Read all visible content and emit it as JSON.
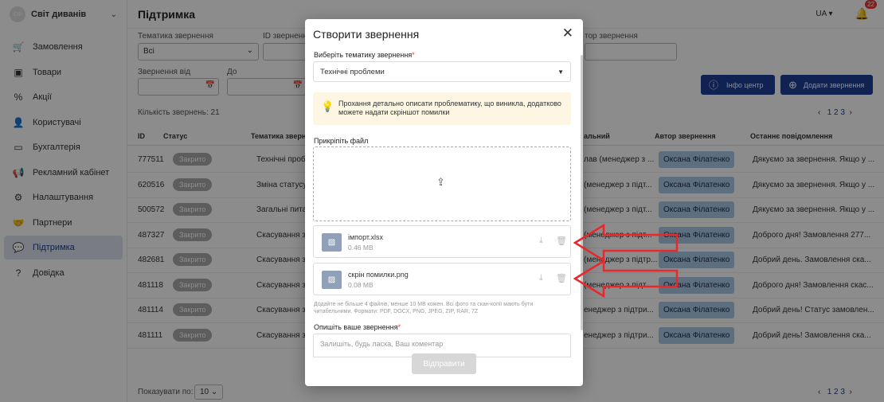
{
  "sidebar": {
    "brand_logo": "СФ",
    "brand_name": "Світ диванів",
    "items": [
      {
        "label": "Замовлення",
        "icon": "cart-icon"
      },
      {
        "label": "Товари",
        "icon": "box-icon"
      },
      {
        "label": "Акції",
        "icon": "tag-icon"
      },
      {
        "label": "Користувачі",
        "icon": "users-icon"
      },
      {
        "label": "Бухгалтерія",
        "icon": "wallet-icon"
      },
      {
        "label": "Рекламний кабінет",
        "icon": "megaphone-icon"
      },
      {
        "label": "Налаштування",
        "icon": "gear-icon"
      },
      {
        "label": "Партнери",
        "icon": "handshake-icon"
      },
      {
        "label": "Підтримка",
        "icon": "chat-icon",
        "active": true
      },
      {
        "label": "Довідка",
        "icon": "help-icon"
      }
    ]
  },
  "header": {
    "title": "Підтримка",
    "lang": "UA",
    "notifications": "22"
  },
  "filters": {
    "topic_label": "Тематика звернення",
    "topic_value": "Всі",
    "id_label": "ID звернення",
    "author_label": "тор звернення",
    "date_from_label": "Звернення від",
    "date_to_label": "До"
  },
  "actions": {
    "info_center": "Інфо центр",
    "add_request": "Додати звернення"
  },
  "list": {
    "count_text": "Кількість звернень: 21",
    "pages": "1 2 3",
    "columns": [
      "ID",
      "Статус",
      "Тематика звернення",
      "альний",
      "Автор звернення",
      "Останнє повідомлення"
    ],
    "rows": [
      {
        "id": "777511",
        "status": "Закрито",
        "topic": "Технічні пробл",
        "resp": "лав (менеджер з ...",
        "author": "Оксана Філатенко",
        "last": "Дякуємо за звернення. Якщо у ..."
      },
      {
        "id": "620516",
        "status": "Закрито",
        "topic": "Зміна статусу",
        "resp": "(менеджер з підт...",
        "author": "Оксана Філатенко",
        "last": "Дякуємо за звернення. Якщо у ..."
      },
      {
        "id": "500572",
        "status": "Закрито",
        "topic": "Загальні пита",
        "resp": "(менеджер з підт...",
        "author": "Оксана Філатенко",
        "last": "Дякуємо за звернення. Якщо у ..."
      },
      {
        "id": "487327",
        "status": "Закрито",
        "topic": "Скасування за",
        "resp": "(менеджер з підт...",
        "author": "Оксана Філатенко",
        "last": "Доброго дня! Замовлення 277..."
      },
      {
        "id": "482681",
        "status": "Закрито",
        "topic": "Скасування за",
        "resp": "(менеджер з підтр...",
        "author": "Оксана Філатенко",
        "last": "Добрий день. Замовлення ска..."
      },
      {
        "id": "481118",
        "status": "Закрито",
        "topic": "Скасування за",
        "resp": "(менеджер з підт...",
        "author": "Оксана Філатенко",
        "last": "Доброго дня! Замовлення скас..."
      },
      {
        "id": "481114",
        "status": "Закрито",
        "topic": "Скасування за",
        "resp": "енеджер з підтри...",
        "author": "Оксана Філатенко",
        "last": "Добрий день! Статус замовлен..."
      },
      {
        "id": "481111",
        "status": "Закрито",
        "topic": "Скасування за",
        "resp": "енеджер з підтри...",
        "author": "Оксана Філатенко",
        "last": "Добрий день! Замовлення ска..."
      }
    ],
    "per_page_label": "Показувати по:",
    "per_page_value": "10"
  },
  "modal": {
    "title": "Створити звернення",
    "topic_label": "Виберіть тематику звернення",
    "topic_value": "Технічні проблеми",
    "hint": "Прохання детально описати проблематику, що виникла, додатково можете надати скріншот помилки",
    "attach_label": "Прикріпіть файл",
    "files": [
      {
        "name": "імпорт.xlsx",
        "size": "0.46 MB"
      },
      {
        "name": "скрін помилки.png",
        "size": "0.08 MB"
      }
    ],
    "help": "Додайте не більше 4 файлів, менше 10 MB кожен. Всі фото та скан-копії мають бути читабельними. Формати: PDF, DOCX, PNG, JPEG, ZIP, RAR, 7Z",
    "describe_label": "Опишіть ваше звернення",
    "describe_placeholder": "Залишіть, будь ласка, Ваш коментар",
    "submit": "Відправити"
  },
  "colors": {
    "primary": "#1e3f96",
    "annotation": "#e8282a"
  }
}
